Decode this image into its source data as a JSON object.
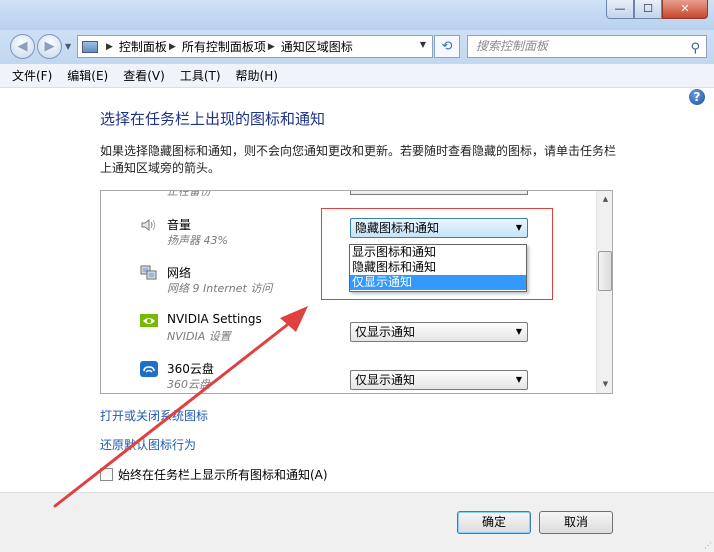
{
  "window": {
    "minimize": "—",
    "maximize": "☐",
    "close": "✕"
  },
  "address": {
    "crumbs": [
      "控制面板",
      "所有控制面板项",
      "通知区域图标"
    ],
    "search_placeholder": "搜索控制面板"
  },
  "menu": [
    "文件(F)",
    "编辑(E)",
    "查看(V)",
    "工具(T)",
    "帮助(H)"
  ],
  "page": {
    "title": "选择在任务栏上出现的图标和通知",
    "description": "如果选择隐藏图标和通知，则不会向您通知更改和更新。若要随时查看隐藏的图标，请单击任务栏上通知区域旁的箭头。"
  },
  "list": {
    "partial_sub": "正在备份",
    "items": [
      {
        "name": "音量",
        "sub": "扬声器 43%",
        "behavior": "隐藏图标和通知",
        "icon": "speaker-icon"
      },
      {
        "name": "网络",
        "sub": "网络 9 Internet 访问",
        "behavior": "",
        "icon": "network-icon"
      },
      {
        "name": "NVIDIA Settings",
        "sub": "NVIDIA 设置",
        "behavior": "仅显示通知",
        "icon": "nvidia-icon"
      },
      {
        "name": "360云盘",
        "sub": "360云盘",
        "behavior": "仅显示通知",
        "icon": "cloud-disk-icon"
      }
    ],
    "dropdown_options": [
      "显示图标和通知",
      "隐藏图标和通知",
      "仅显示通知"
    ],
    "dropdown_highlighted": 2
  },
  "links": {
    "system_icons": "打开或关闭系统图标",
    "restore_defaults": "还原默认图标行为"
  },
  "always_show": {
    "label": "始终在任务栏上显示所有图标和通知(A)",
    "checked": false
  },
  "buttons": {
    "ok": "确定",
    "cancel": "取消"
  },
  "colors": {
    "title": "#1e3287",
    "link": "#1f5bb6",
    "annotation": "#e04040",
    "selection": "#3399ff"
  }
}
